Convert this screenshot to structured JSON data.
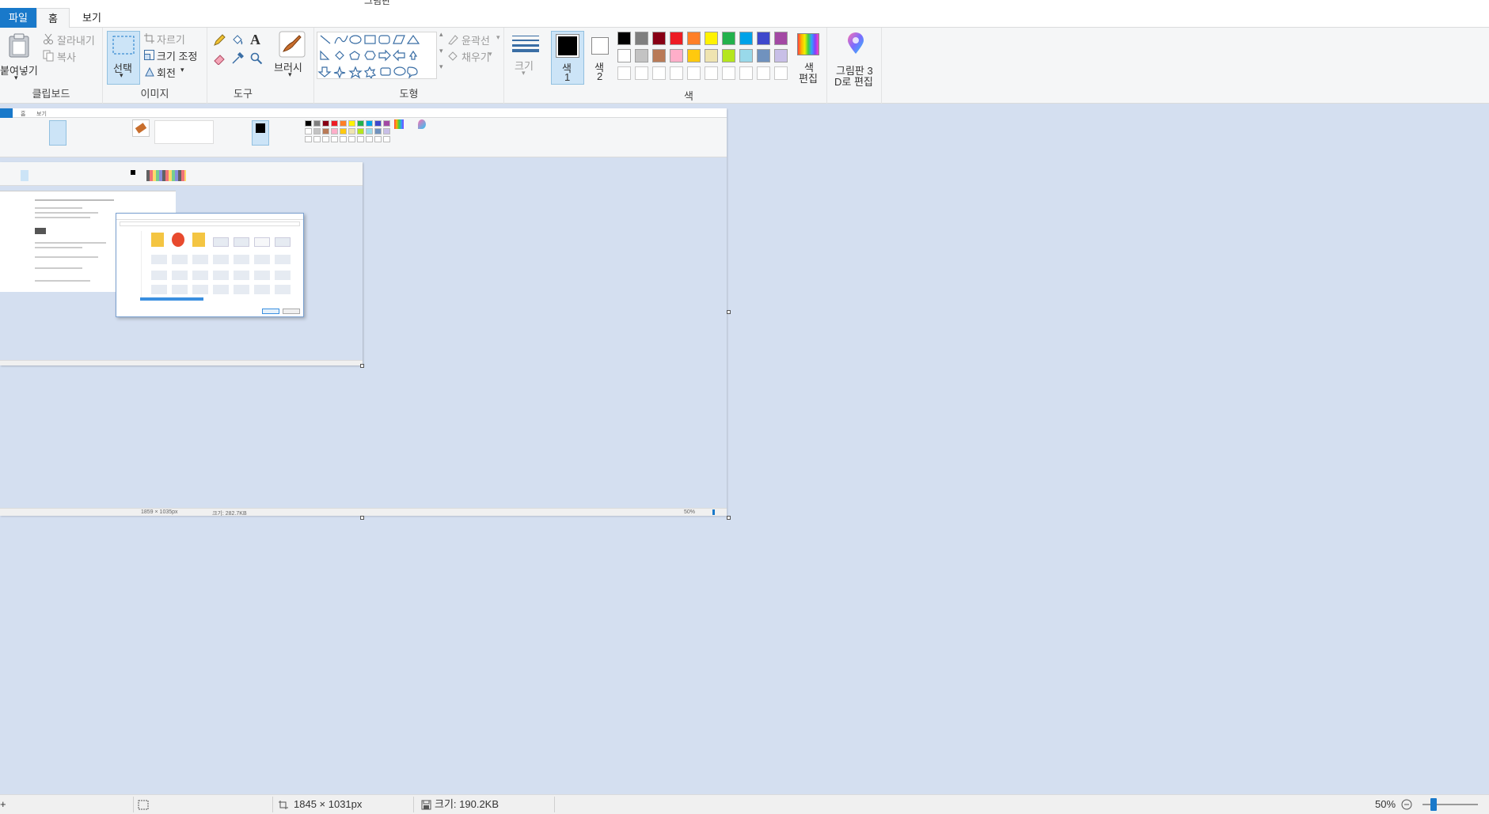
{
  "window": {
    "title": "그림판",
    "quick_access": "▪ ▾"
  },
  "tabs": {
    "file": "파일",
    "home": "홈",
    "view": "보기"
  },
  "ribbon": {
    "clipboard": {
      "paste": "붙여넣기",
      "cut": "잘라내기",
      "copy": "복사",
      "label": "클립보드"
    },
    "image": {
      "select": "선택",
      "crop": "자르기",
      "resize": "크기 조정",
      "rotate": "회전",
      "label": "이미지"
    },
    "tools": {
      "label": "도구"
    },
    "brushes": {
      "label": "브러시"
    },
    "shapes": {
      "outline": "윤곽선",
      "fill": "채우기",
      "label": "도형"
    },
    "size": {
      "label": "크기"
    },
    "colors": {
      "color1_top": "색",
      "color1_bottom": "1",
      "color2_top": "색",
      "color2_bottom": "2",
      "edit_top": "색",
      "edit_bottom": "편집",
      "label": "색",
      "palette_row1": [
        "#000000",
        "#7f7f7f",
        "#880015",
        "#ed1c24",
        "#ff7f27",
        "#fff200",
        "#22b14c",
        "#00a2e8",
        "#3f48cc",
        "#a349a4"
      ],
      "palette_row2": [
        "#ffffff",
        "#c3c3c3",
        "#b97a57",
        "#ffaec9",
        "#ffc90e",
        "#efe4b0",
        "#b5e61d",
        "#99d9ea",
        "#7092be",
        "#c8bfe7"
      ],
      "palette_row3": [
        "#ffffff",
        "#ffffff",
        "#ffffff",
        "#ffffff",
        "#ffffff",
        "#ffffff",
        "#ffffff",
        "#ffffff",
        "#ffffff",
        "#ffffff"
      ]
    },
    "paint3d": {
      "line1": "그림판 3",
      "line2": "D로 편집"
    }
  },
  "canvas": {
    "nested_status_size": "1859 × 1035px",
    "nested_status_filesize": "크기: 282.7KB",
    "nested_status_zoom": "50%",
    "nested_file_tab": "파일",
    "nested_home_tab": "홈",
    "nested_view_tab": "보기"
  },
  "statusbar": {
    "dimensions": "1845 × 1031px",
    "filesize": "크기: 190.2KB",
    "zoom": "50%",
    "zoom_level_fraction": 0.5
  }
}
